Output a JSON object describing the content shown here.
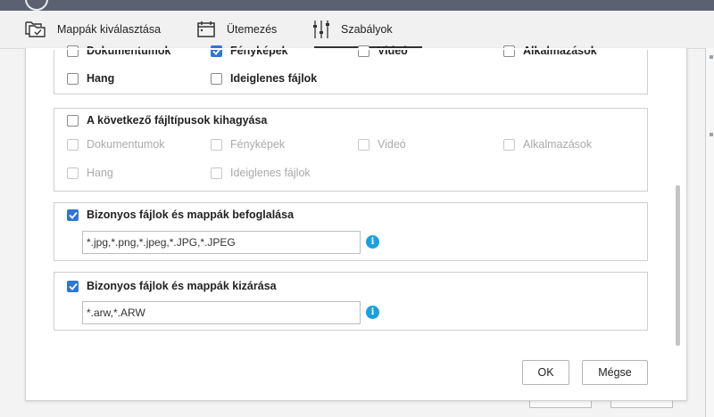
{
  "tabs": [
    {
      "label": "Mappák kiválasztása",
      "icon": "folders-icon"
    },
    {
      "label": "Ütemezés",
      "icon": "calendar-icon"
    },
    {
      "label": "Szabályok",
      "icon": "sliders-icon",
      "active": true
    }
  ],
  "include_types": {
    "options": [
      {
        "label": "Dokumentumok",
        "checked": false
      },
      {
        "label": "Fényképek",
        "checked": true
      },
      {
        "label": "Videó",
        "checked": false
      },
      {
        "label": "Alkalmazások",
        "checked": false
      },
      {
        "label": "Hang",
        "checked": false
      },
      {
        "label": "Ideiglenes fájlok",
        "checked": false
      }
    ]
  },
  "skip_types": {
    "label": "A következő fájltípusok kihagyása",
    "checked": false,
    "options": [
      {
        "label": "Dokumentumok",
        "disabled": true
      },
      {
        "label": "Fényképek",
        "disabled": true
      },
      {
        "label": "Videó",
        "disabled": true
      },
      {
        "label": "Alkalmazások",
        "disabled": true
      },
      {
        "label": "Hang",
        "disabled": true
      },
      {
        "label": "Ideiglenes fájlok",
        "disabled": true
      }
    ]
  },
  "include_files": {
    "label": "Bizonyos fájlok és mappák befoglalása",
    "checked": true,
    "value": "*.jpg,*.png,*.jpeg,*.JPG,*.JPEG",
    "info_icon": "info-icon"
  },
  "exclude_files": {
    "label": "Bizonyos fájlok és mappák kizárása",
    "checked": true,
    "value": "*.arw,*.ARW",
    "info_icon": "info-icon"
  },
  "buttons": {
    "ok": "OK",
    "cancel": "Mégse"
  },
  "colors": {
    "accent": "#2f76d2",
    "info": "#1a9fe0",
    "disabled_text": "#aaaaaa",
    "topbar": "#5b6170"
  }
}
